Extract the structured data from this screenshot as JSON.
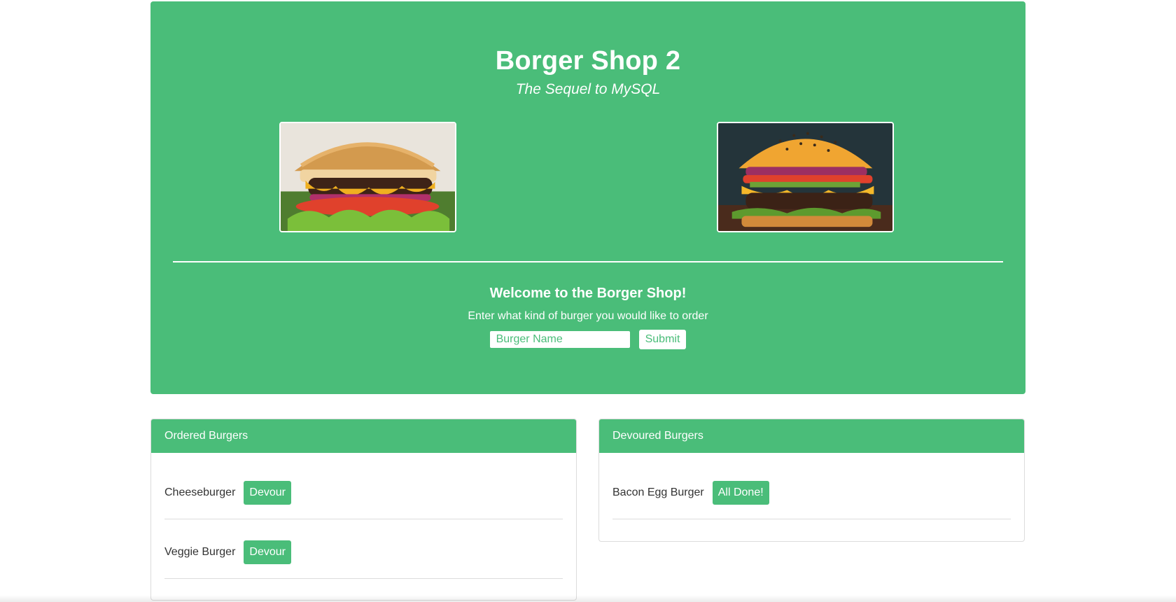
{
  "header": {
    "title": "Borger Shop 2",
    "subtitle": "The Sequel to MySQL"
  },
  "images": [
    {
      "name": "burger-photo-left"
    },
    {
      "name": "burger-photo-right"
    }
  ],
  "order_form": {
    "welcome": "Welcome to the Borger Shop!",
    "instructions": "Enter what kind of burger you would like to order",
    "input_placeholder": "Burger Name",
    "input_value": "",
    "submit_label": "Submit"
  },
  "ordered": {
    "header": "Ordered Burgers",
    "items": [
      {
        "name": "Cheeseburger",
        "action": "Devour"
      },
      {
        "name": "Veggie Burger",
        "action": "Devour"
      }
    ]
  },
  "devoured": {
    "header": "Devoured Burgers",
    "items": [
      {
        "name": "Bacon Egg Burger",
        "action": "All Done!"
      }
    ]
  },
  "colors": {
    "brand_green": "#4abd79",
    "white": "#ffffff"
  }
}
